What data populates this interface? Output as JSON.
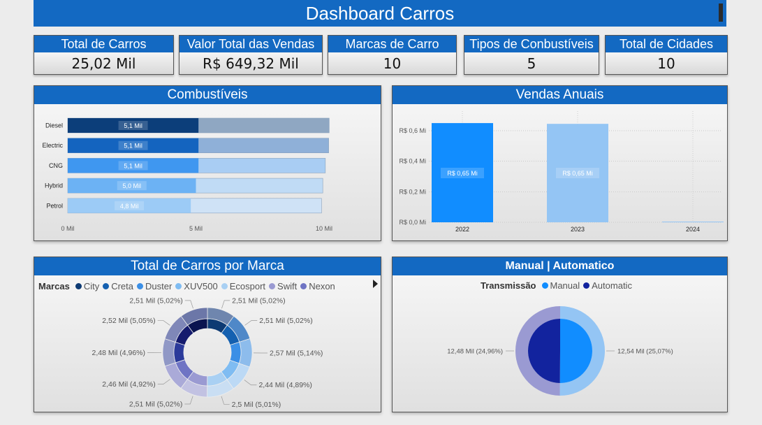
{
  "header": {
    "title": "Dashboard Carros"
  },
  "kpis": [
    {
      "title": "Total de Carros",
      "value": "25,02 Mil"
    },
    {
      "title": "Valor Total das Vendas",
      "value": "R$ 649,32 Mil"
    },
    {
      "title": "Marcas de Carro",
      "value": "10"
    },
    {
      "title": "Tipos de Conbustíveis",
      "value": "5"
    },
    {
      "title": "Total de Cidades",
      "value": "10"
    }
  ],
  "panels": {
    "fuel": {
      "title": "Combustíveis"
    },
    "annual": {
      "title": "Vendas Anuais"
    },
    "brand": {
      "title": "Total de Carros por Marca"
    },
    "trans": {
      "title": "Manual | Automatico"
    }
  },
  "legends": {
    "brand": {
      "title": "Marcas",
      "items": [
        {
          "name": "City",
          "color": "#0d3a73"
        },
        {
          "name": "Creta",
          "color": "#1460b0"
        },
        {
          "name": "Duster",
          "color": "#3b8fe6"
        },
        {
          "name": "XUV500",
          "color": "#7fbcf2"
        },
        {
          "name": "Ecosport",
          "color": "#a9d0f3"
        },
        {
          "name": "Swift",
          "color": "#9a9ad2"
        },
        {
          "name": "Nexon",
          "color": "#6f74c4"
        }
      ]
    },
    "trans": {
      "title": "Transmissão",
      "items": [
        {
          "name": "Manual",
          "color": "#118dff"
        },
        {
          "name": "Automatic",
          "color": "#12239e"
        }
      ]
    }
  },
  "chart_data": [
    {
      "id": "fuel",
      "type": "bar",
      "orientation": "horizontal",
      "categories": [
        "Diesel",
        "Electric",
        "CNG",
        "Hybrid",
        "Petrol"
      ],
      "values": [
        5.1,
        5.1,
        5.1,
        5.0,
        4.8
      ],
      "totals": [
        10.2,
        10.18,
        10.05,
        9.95,
        9.9
      ],
      "data_labels": [
        "5,1 Mil",
        "5,1 Mil",
        "5,1 Mil",
        "5,0 Mil",
        "4,8 Mil"
      ],
      "xticks": [
        "0 Mil",
        "5 Mil",
        "10 Mil"
      ],
      "xlim": [
        0,
        10
      ],
      "colors": [
        "#0c3e7a",
        "#1464bf",
        "#3f97f0",
        "#6cb2f4",
        "#9ccbf6"
      ],
      "remainder_colors": [
        "#8fa7c2",
        "#8fb0d8",
        "#a9cdf3",
        "#c0dbf5",
        "#cfe2f6"
      ]
    },
    {
      "id": "annual",
      "type": "bar",
      "categories": [
        "2022",
        "2023",
        "2024"
      ],
      "values": [
        0.65,
        0.645,
        0.002
      ],
      "data_labels": [
        "R$ 0,65 Mi",
        "R$ 0,65 Mi",
        ""
      ],
      "yticks": [
        "R$ 0,0 Mi",
        "R$ 0,2 Mi",
        "R$ 0,4 Mi",
        "R$ 0,6 Mi"
      ],
      "ylim": [
        0,
        0.6
      ],
      "colors": [
        "#118dff",
        "#94c5f4",
        "#94c5f4"
      ]
    },
    {
      "id": "brand",
      "type": "pie",
      "labels": [
        "2,51 Mil (5,02%)",
        "2,51 Mil (5,02%)",
        "2,57 Mil (5,14%)",
        "2,44 Mil (4,89%)",
        "2,5 Mil (5,01%)",
        "2,51 Mil (5,02%)",
        "2,46 Mil (4,92%)",
        "2,48 Mil (4,96%)",
        "2,52 Mil (5,05%)",
        "2,51 Mil (5,02%)"
      ],
      "values": [
        2.51,
        2.51,
        2.57,
        2.44,
        2.5,
        2.51,
        2.46,
        2.48,
        2.52,
        2.51
      ],
      "colors": [
        "#0d3a73",
        "#1460b0",
        "#3b8fe6",
        "#7fbcf2",
        "#a9d0f3",
        "#9a9ad2",
        "#6f74c4",
        "#2b3a9a",
        "#151b6e",
        "#0a1450"
      ]
    },
    {
      "id": "trans",
      "type": "pie",
      "series": [
        {
          "name": "Manual",
          "value": 12.54,
          "label": "12,54 Mil (25,07%)"
        },
        {
          "name": "Automatic",
          "value": 12.48,
          "label": "12,48 Mil (24,96%)"
        }
      ],
      "colors": [
        "#118dff",
        "#12239e"
      ]
    }
  ]
}
